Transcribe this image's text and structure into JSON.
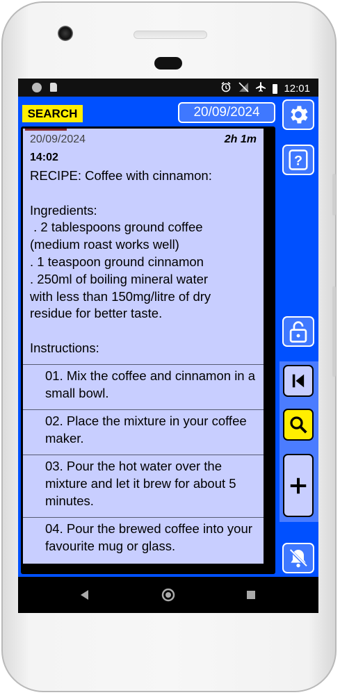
{
  "status_bar": {
    "time": "12:01",
    "icons": [
      "notification-dot-icon",
      "sd-card-icon",
      "alarm-icon",
      "no-signal-icon",
      "airplane-icon",
      "battery-icon"
    ]
  },
  "toolbar": {
    "search_label": "SEARCH",
    "date_label": "20/09/2024",
    "icons": [
      "settings-gear-icon",
      "help-question-icon",
      "unlock-icon",
      "first-page-icon",
      "search-icon",
      "add-plus-icon",
      "bell-off-icon"
    ]
  },
  "note": {
    "date": "20/09/2024",
    "duration": "2h 1m",
    "time": "14:02",
    "body": "RECIPE: Coffee with cinnamon:\n\nIngredients:\n . 2 tablespoons ground coffee\n(medium roast works well)\n. 1 teaspoon ground cinnamon\n. 250ml of boiling mineral water\nwith less than 150mg/litre of dry\nresidue for better taste.\n\nInstructions:",
    "steps": [
      "01. Mix the coffee and cinnamon in a small bowl.",
      "02. Place the mixture in your coffee maker.",
      "03. Pour the hot water over the mixture and let it brew for about 5 minutes.",
      "04. Pour the brewed coffee into your favourite mug or glass."
    ]
  },
  "colors": {
    "app_background": "#0050ff",
    "search_button": "#ffee00",
    "card_background": "#c8ceff",
    "side_button": "#3f78ff",
    "nav_panel": "#4b7cff"
  },
  "system_nav": [
    "back-icon",
    "home-icon",
    "recents-icon"
  ]
}
